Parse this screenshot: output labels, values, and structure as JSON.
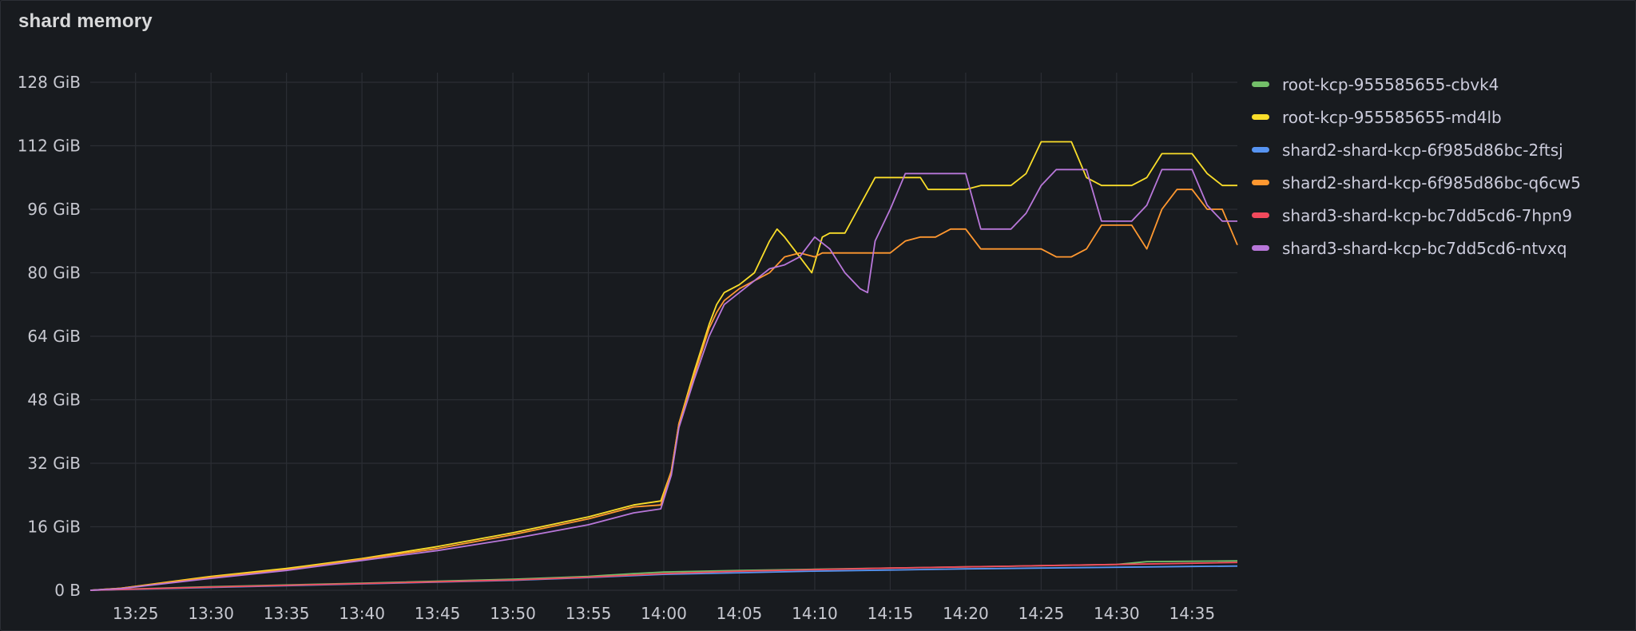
{
  "panel": {
    "title": "shard memory"
  },
  "chart_data": {
    "type": "line",
    "title": "shard memory",
    "xlabel": "",
    "ylabel": "",
    "x_unit": "time",
    "y_unit": "GiB",
    "xlim": [
      "13:22",
      "14:38"
    ],
    "ylim": [
      0,
      128
    ],
    "y_ticks": [
      0,
      16,
      32,
      48,
      64,
      80,
      96,
      112,
      128
    ],
    "y_tick_labels": [
      "0 B",
      "16 GiB",
      "32 GiB",
      "48 GiB",
      "64 GiB",
      "80 GiB",
      "96 GiB",
      "112 GiB",
      "128 GiB"
    ],
    "x_ticks": [
      "13:25",
      "13:30",
      "13:35",
      "13:40",
      "13:45",
      "13:50",
      "13:55",
      "14:00",
      "14:05",
      "14:10",
      "14:15",
      "14:20",
      "14:25",
      "14:30",
      "14:35"
    ],
    "grid": true,
    "legend_position": "right",
    "series": [
      {
        "name": "root-kcp-955585655-cbvk4",
        "color": "#73bf69",
        "x": [
          "13:22",
          "13:30",
          "13:40",
          "13:50",
          "13:55",
          "13:58",
          "14:00",
          "14:05",
          "14:10",
          "14:15",
          "14:20",
          "14:25",
          "14:30",
          "14:32",
          "14:38"
        ],
        "y": [
          0,
          0.9,
          1.8,
          2.8,
          3.5,
          4.2,
          4.6,
          5.0,
          5.3,
          5.6,
          5.9,
          6.2,
          6.5,
          7.2,
          7.4
        ]
      },
      {
        "name": "root-kcp-955585655-md4lb",
        "color": "#fade2a",
        "x": [
          "13:22",
          "13:24",
          "13:30",
          "13:35",
          "13:40",
          "13:45",
          "13:50",
          "13:55",
          "13:58",
          "13:59.8",
          "14:00.5",
          "14:01",
          "14:02",
          "14:03",
          "14:03.5",
          "14:04",
          "14:05",
          "14:06",
          "14:07",
          "14:07.5",
          "14:08",
          "14:09",
          "14:09.8",
          "14:10.5",
          "14:11",
          "14:12",
          "14:13",
          "14:14",
          "14:15",
          "14:16",
          "14:17",
          "14:17.5",
          "14:20",
          "14:21",
          "14:22",
          "14:23",
          "14:24",
          "14:25",
          "14:26",
          "14:27",
          "14:28",
          "14:29",
          "14:30",
          "14:31",
          "14:32",
          "14:33",
          "14:34",
          "14:35",
          "14:36",
          "14:37",
          "14:38"
        ],
        "y": [
          0,
          0.5,
          3.5,
          5.5,
          8,
          11,
          14.5,
          18.5,
          21.5,
          22.5,
          30,
          42,
          55,
          67,
          72,
          75,
          77,
          80,
          88,
          91,
          89,
          84,
          80,
          89,
          90,
          90,
          97,
          104,
          104,
          104,
          104,
          101,
          101,
          102,
          102,
          102,
          105,
          113,
          113,
          113,
          104,
          102,
          102,
          102,
          104,
          110,
          110,
          110,
          105,
          102,
          102
        ]
      },
      {
        "name": "shard2-shard-kcp-6f985d86bc-2ftsj",
        "color": "#5794f2",
        "x": [
          "13:22",
          "13:30",
          "13:40",
          "13:50",
          "13:55",
          "14:00",
          "14:05",
          "14:10",
          "14:15",
          "14:20",
          "14:25",
          "14:30",
          "14:35",
          "14:38"
        ],
        "y": [
          0,
          0.7,
          1.6,
          2.5,
          3.2,
          4.0,
          4.4,
          4.8,
          5.1,
          5.4,
          5.6,
          5.8,
          6.0,
          6.1
        ]
      },
      {
        "name": "shard2-shard-kcp-6f985d86bc-q6cw5",
        "color": "#ff9830",
        "x": [
          "13:22",
          "13:24",
          "13:30",
          "13:35",
          "13:40",
          "13:45",
          "13:50",
          "13:55",
          "13:58",
          "13:59.8",
          "14:00.5",
          "14:01",
          "14:02",
          "14:03",
          "14:03.5",
          "14:04",
          "14:05",
          "14:06",
          "14:07",
          "14:08",
          "14:09",
          "14:10",
          "14:10.5",
          "14:15",
          "14:16",
          "14:17",
          "14:18",
          "14:19",
          "14:20",
          "14:21",
          "14:22",
          "14:25",
          "14:26",
          "14:27",
          "14:28",
          "14:29",
          "14:30",
          "14:31",
          "14:32",
          "14:33",
          "14:34",
          "14:35",
          "14:36",
          "14:37",
          "14:38"
        ],
        "y": [
          0,
          0.5,
          3.3,
          5.2,
          7.8,
          10.5,
          14,
          18,
          21,
          21.5,
          30,
          42,
          54,
          66,
          70,
          73,
          76,
          78,
          80,
          84,
          85,
          84,
          85,
          85,
          88,
          89,
          89,
          91,
          91,
          86,
          86,
          86,
          84,
          84,
          86,
          92,
          92,
          92,
          86,
          96,
          101,
          101,
          96,
          96,
          87
        ]
      },
      {
        "name": "shard3-shard-kcp-bc7dd5cd6-7hpn9",
        "color": "#f2495c",
        "x": [
          "13:22",
          "13:30",
          "13:40",
          "13:50",
          "13:55",
          "14:00",
          "14:05",
          "14:10",
          "14:15",
          "14:20",
          "14:25",
          "14:30",
          "14:35",
          "14:38"
        ],
        "y": [
          0,
          0.8,
          1.7,
          2.6,
          3.3,
          4.2,
          4.8,
          5.2,
          5.6,
          5.9,
          6.2,
          6.5,
          6.8,
          7.0
        ]
      },
      {
        "name": "shard3-shard-kcp-bc7dd5cd6-ntvxq",
        "color": "#b877d9",
        "x": [
          "13:22",
          "13:24",
          "13:30",
          "13:35",
          "13:40",
          "13:45",
          "13:50",
          "13:55",
          "13:58",
          "13:59.8",
          "14:00.5",
          "14:01",
          "14:02",
          "14:03",
          "14:03.5",
          "14:04",
          "14:05",
          "14:06",
          "14:07",
          "14:08",
          "14:09",
          "14:10",
          "14:11",
          "14:12",
          "14:13",
          "14:13.5",
          "14:14",
          "14:15",
          "14:16",
          "14:17",
          "14:18",
          "14:19",
          "14:20",
          "14:21",
          "14:22",
          "14:23",
          "14:24",
          "14:25",
          "14:26",
          "14:27",
          "14:28",
          "14:29",
          "14:30",
          "14:31",
          "14:32",
          "14:33",
          "14:34",
          "14:35",
          "14:36",
          "14:37",
          "14:38"
        ],
        "y": [
          0,
          0.4,
          3,
          5,
          7.5,
          10,
          13,
          16.5,
          19.5,
          20.5,
          29,
          41,
          53,
          64,
          68,
          72,
          75,
          78,
          81,
          82,
          84,
          89,
          86,
          80,
          76,
          75,
          88,
          96,
          105,
          105,
          105,
          105,
          105,
          91,
          91,
          91,
          95,
          102,
          106,
          106,
          106,
          93,
          93,
          93,
          97,
          106,
          106,
          106,
          97,
          93,
          93
        ]
      }
    ]
  }
}
